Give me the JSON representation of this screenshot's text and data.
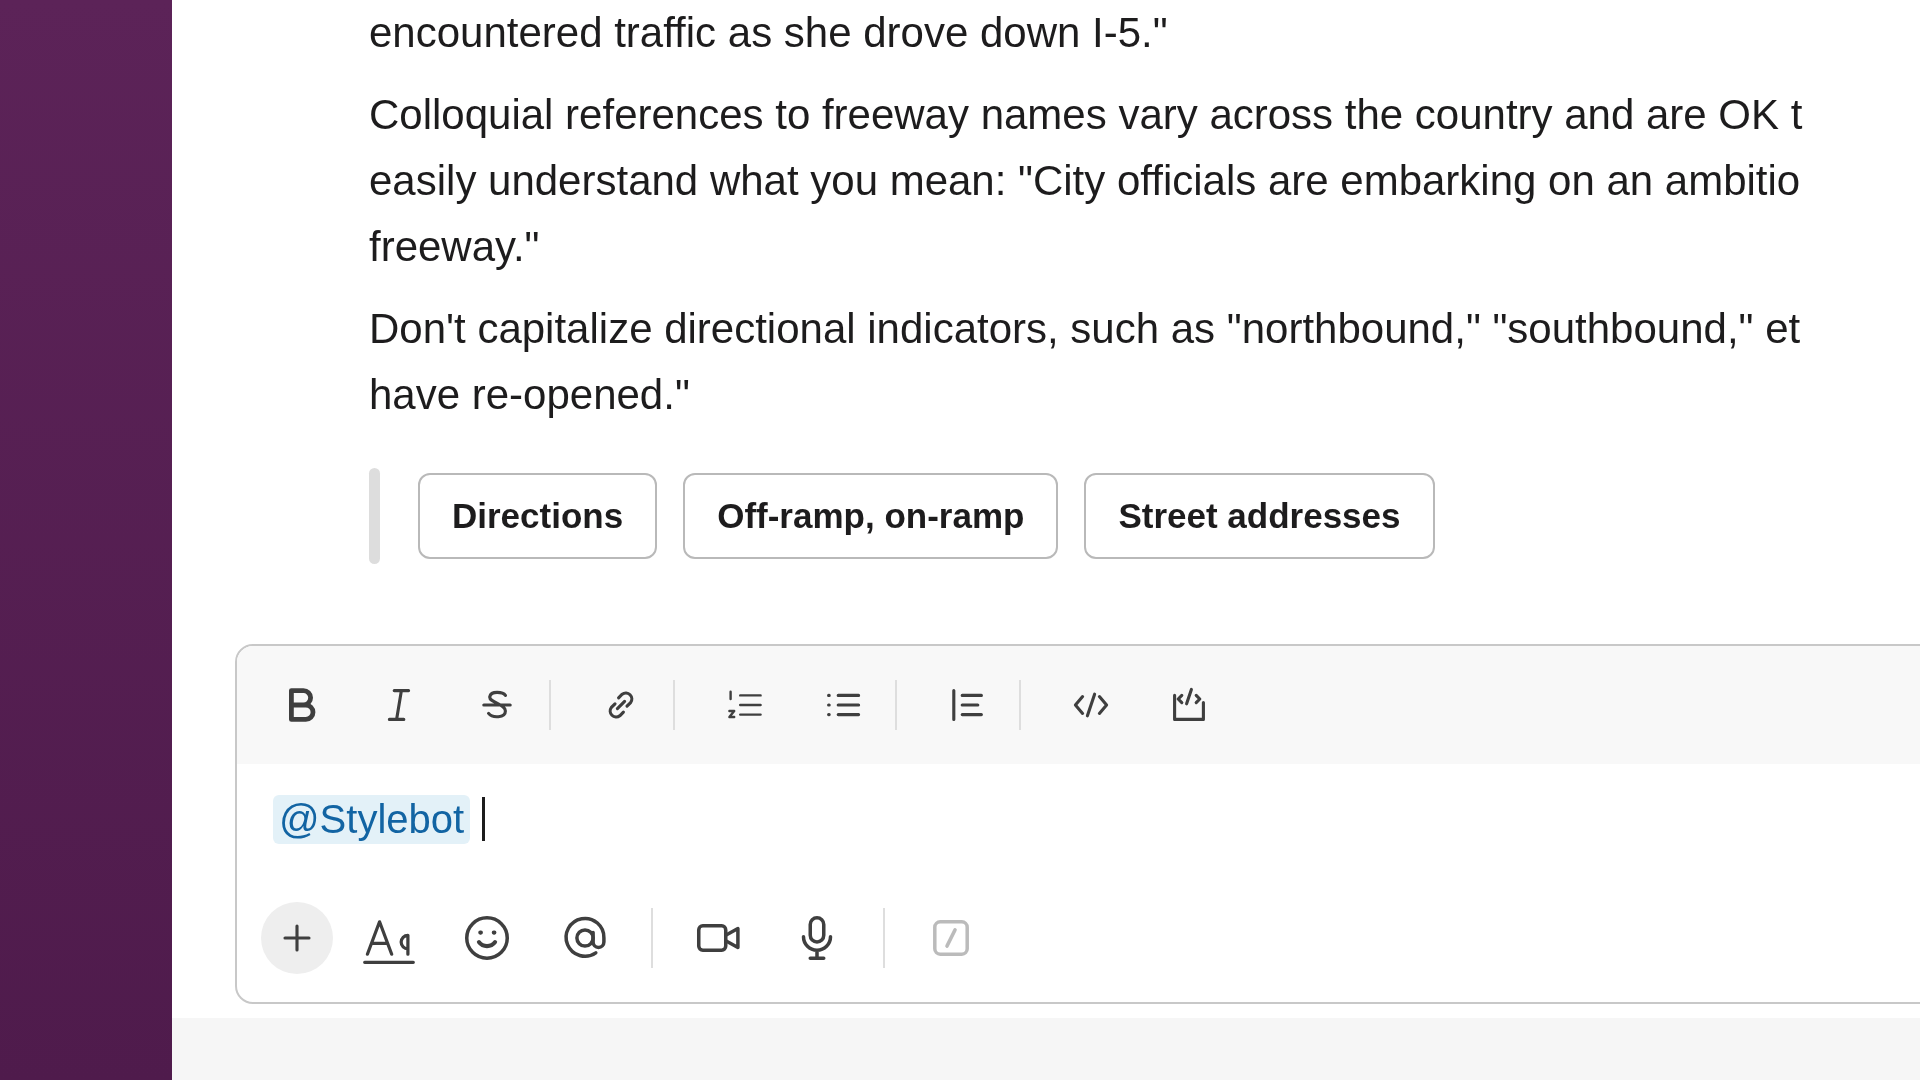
{
  "message": {
    "paragraphs": [
      {
        "lines": [
          "encountered traffic as she drove down I-5.\""
        ]
      },
      {
        "lines": [
          "Colloquial references to freeway names vary across the country and are OK t",
          "easily understand what you mean: \"City officials are embarking on an ambitio",
          "freeway.\""
        ]
      },
      {
        "lines": [
          "Don't capitalize directional indicators, such as \"northbound,\" \"southbound,\" et",
          "have re-opened.\""
        ]
      }
    ],
    "buttons": [
      "Directions",
      "Off-ramp, on-ramp",
      "Street addresses"
    ]
  },
  "composer": {
    "mention": "@Stylebot",
    "shortcuts": {
      "disabled": true
    }
  }
}
